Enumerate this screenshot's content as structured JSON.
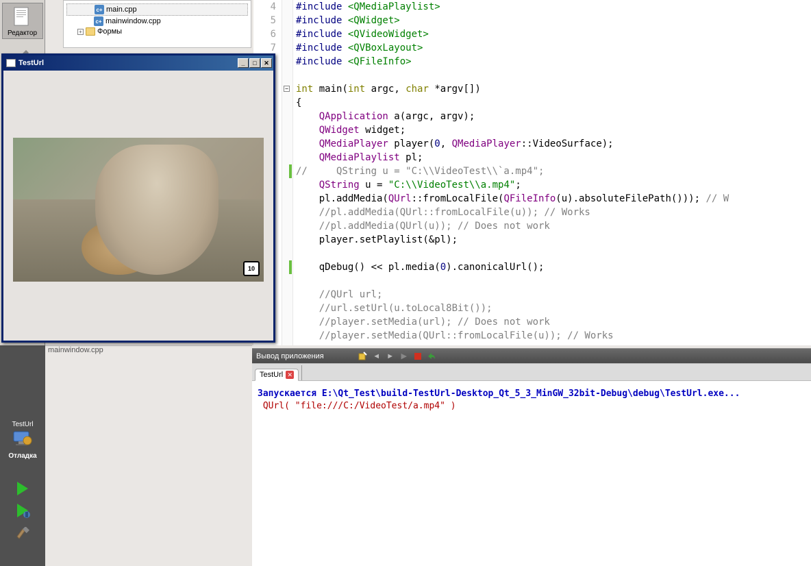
{
  "sidebar": {
    "editor_label": "Редактор"
  },
  "tree": {
    "file1": "main.cpp",
    "file2": "mainwindow.cpp",
    "forms": "Формы"
  },
  "editor": {
    "lines": {
      "l4": "4",
      "l5": "5",
      "l6": "6",
      "l7": "7"
    },
    "code": {
      "l4a": "#include ",
      "l4b": "<QMediaPlaylist>",
      "l5a": "#include ",
      "l5b": "<QWidget>",
      "l6a": "#include ",
      "l6b": "<QVideoWidget>",
      "l7a": "#include ",
      "l7b": "<QVBoxLayout>",
      "l8a": "#include ",
      "l8b": "<QFileInfo>",
      "l10_int": "int",
      "l10_main": " main(",
      "l10_int2": "int",
      "l10_argc": " argc, ",
      "l10_char": "char",
      "l10_rest": " *argv[])",
      "l11": "{",
      "l12_t": "    QApplication",
      "l12_r": " a(argc, argv);",
      "l13_t": "    QWidget",
      "l13_r": " widget;",
      "l14_t": "    QMediaPlayer",
      "l14_r": " player(",
      "l14_n": "0",
      "l14_c": ", ",
      "l14_t2": "QMediaPlayer",
      "l14_r2": "::VideoSurface);",
      "l15_t": "    QMediaPlaylist",
      "l15_r": " pl;",
      "l16": "//     QString u = \"C:\\\\VideoTest\\\\`a.mp4\";",
      "l17_t": "    QString",
      "l17_r": " u = ",
      "l17_s": "\"C:\\\\VideoTest\\\\a.mp4\"",
      "l17_e": ";",
      "l18_a": "    pl.addMedia(",
      "l18_t": "QUrl",
      "l18_b": "::fromLocalFile(",
      "l18_t2": "QFileInfo",
      "l18_c": "(u).absoluteFilePath())); ",
      "l18_cm": "// W",
      "l19": "    //pl.addMedia(QUrl::fromLocalFile(u)); // Works",
      "l20": "    //pl.addMedia(QUrl(u)); // Does not work",
      "l21": "    player.setPlaylist(&pl);",
      "l23_a": "    qDebug() << pl.media(",
      "l23_n": "0",
      "l23_b": ").canonicalUrl();",
      "l25": "    //QUrl url;",
      "l26": "    //url.setUrl(u.toLocal8Bit());",
      "l27": "    //player.setMedia(url); // Does not work",
      "l28": "    //player.setMedia(QUrl::fromLocalFile(u)); // Works"
    }
  },
  "testurl": {
    "title": "TestUrl",
    "route": "10"
  },
  "bottom": {
    "file_tab": "mainwindow.cpp",
    "testurl_label": "TestUrl",
    "debug_label": "Отладка"
  },
  "output": {
    "toolbar_label": "Вывод приложения",
    "tab": "TestUrl",
    "line1": "Запускается E:\\Qt_Test\\build-TestUrl-Desktop_Qt_5_3_MinGW_32bit-Debug\\debug\\TestUrl.exe...",
    "line2": " QUrl( \"file:///C:/VideoTest/a.mp4\" )"
  }
}
